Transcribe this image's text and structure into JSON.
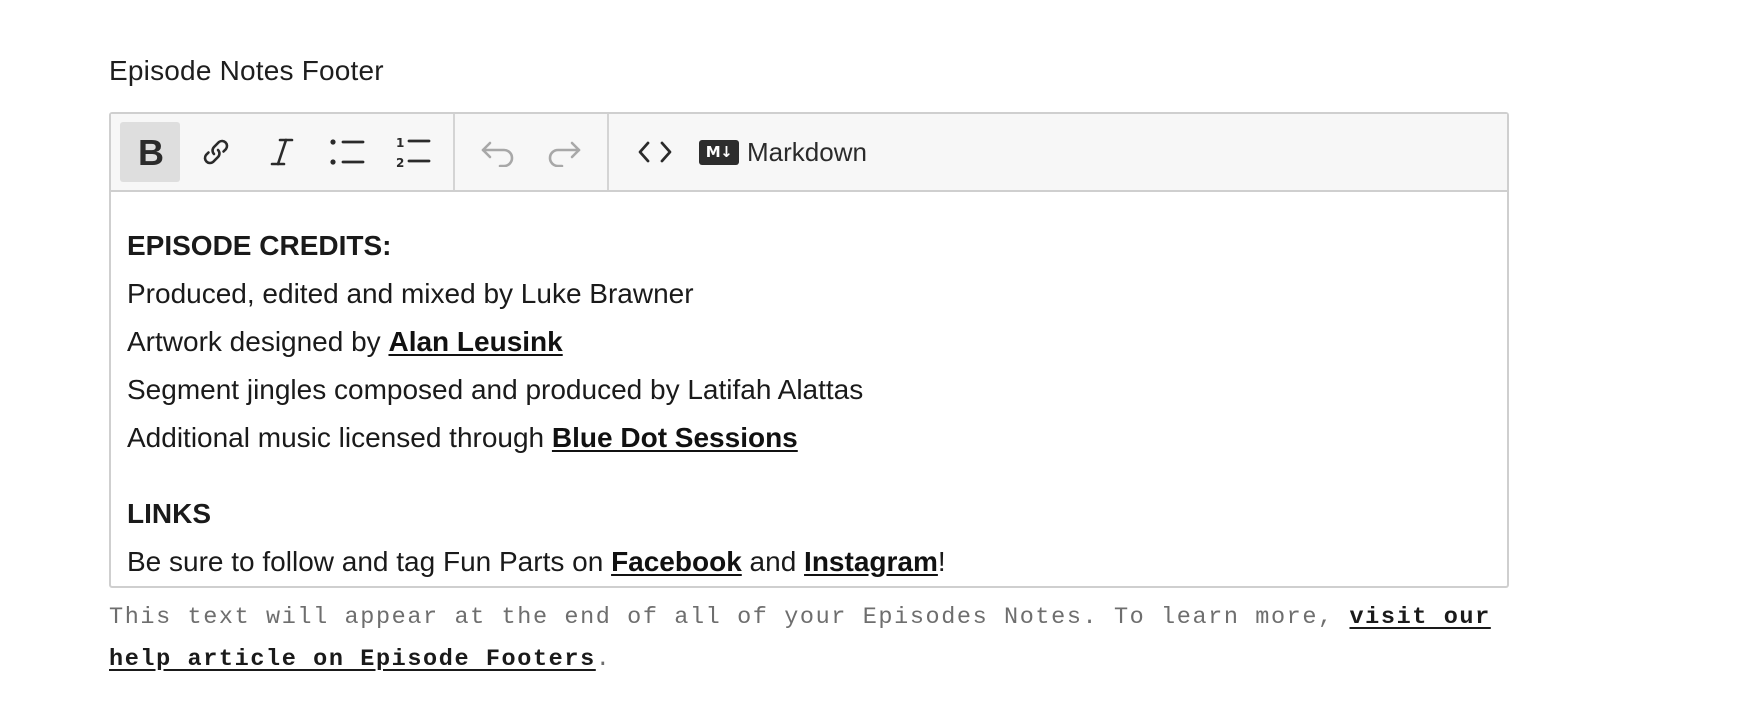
{
  "field": {
    "label": "Episode Notes Footer"
  },
  "toolbar": {
    "bold": "bold-icon",
    "link": "link-icon",
    "italic": "italic-icon",
    "bullet_list": "bullet-list-icon",
    "ordered_list": "ordered-list-icon",
    "undo": "undo-icon",
    "redo": "redo-icon",
    "code": "code-icon",
    "markdown_badge": "M↓",
    "markdown_label": "Markdown"
  },
  "content": {
    "credits_heading": "EPISODE CREDITS:",
    "line1": "Produced, edited and mixed by Luke Brawner",
    "line2_prefix": "Artwork designed by ",
    "line2_link": "Alan Leusink",
    "line3": "Segment jingles composed and produced by Latifah Alattas",
    "line4_prefix": "Additional music licensed through ",
    "line4_link": "Blue Dot Sessions",
    "links_heading": "LINKS",
    "line5_prefix": "Be sure to follow and tag Fun Parts on ",
    "line5_link1": "Facebook",
    "line5_mid": " and ",
    "line5_link2": "Instagram",
    "line5_suffix": "!"
  },
  "help": {
    "text": "This text will appear at the end of all of your Episodes Notes. To learn more, ",
    "link": "visit our help article on Episode Footers",
    "suffix": "."
  },
  "colors": {
    "toolbar_bg": "#f7f7f7",
    "border": "#cfcfcf",
    "active_button": "#dedede",
    "help_text": "#6e6e6e"
  }
}
